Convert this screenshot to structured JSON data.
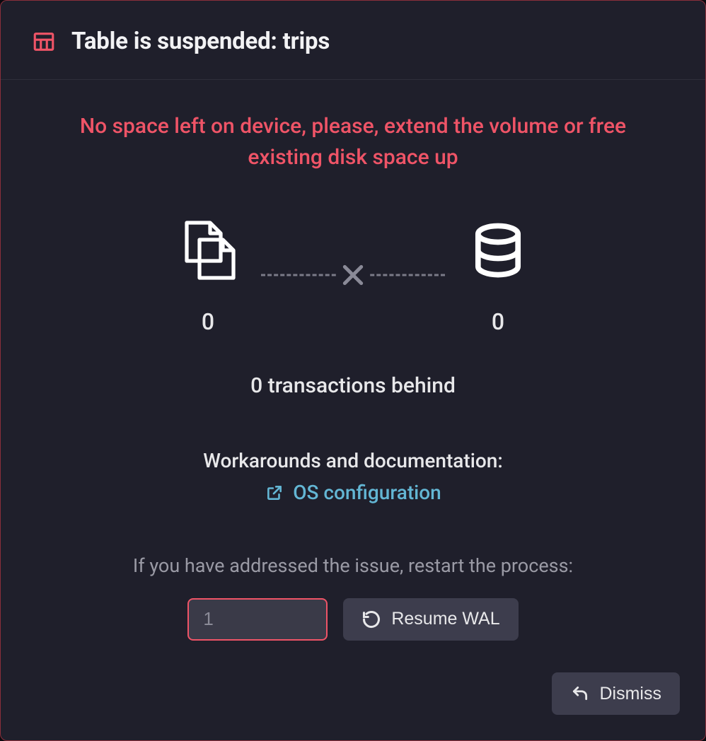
{
  "header": {
    "title": "Table is suspended: trips"
  },
  "error": {
    "message": "No space left on device, please, extend the volume or free existing disk space up"
  },
  "illustration": {
    "file_count": "0",
    "db_count": "0"
  },
  "status": {
    "behind_text": "0 transactions behind"
  },
  "docs": {
    "label": "Workarounds and documentation:",
    "link_label": "OS configuration"
  },
  "restart": {
    "prompt": "If you have addressed the issue, restart the process:",
    "input_placeholder": "1",
    "resume_label": "Resume WAL"
  },
  "footer": {
    "dismiss_label": "Dismiss"
  },
  "colors": {
    "error": "#ef5467",
    "link": "#63b6d4",
    "panel": "#1f1f2b"
  }
}
